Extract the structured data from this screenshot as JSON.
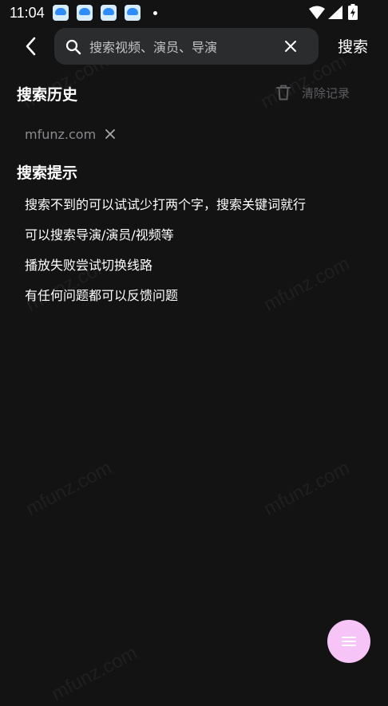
{
  "status_bar": {
    "time": "11:04",
    "notification_icons": [
      "app-notification-icon",
      "app-notification-icon",
      "app-notification-icon",
      "app-notification-icon"
    ]
  },
  "header": {
    "back_icon": "chevron-left-icon",
    "search": {
      "value": "",
      "placeholder": "搜索视频、演员、导演"
    },
    "submit_label": "搜索"
  },
  "history": {
    "title": "搜索历史",
    "clear_label": "清除记录",
    "items": [
      "mfunz.com"
    ]
  },
  "tips": {
    "title": "搜索提示",
    "items": [
      "搜索不到的可以试试少打两个字，搜索关键词就行",
      "可以搜索导演/演员/视频等",
      "播放失败尝试切换线路",
      "有任何问题都可以反馈问题"
    ]
  },
  "watermark": "mfunz.com",
  "fab_icon": "menu-icon",
  "colors": {
    "background": "#131314",
    "search_box": "#2b2c2e",
    "fab": "#f7c4f7",
    "muted_text": "#5c5d60"
  }
}
